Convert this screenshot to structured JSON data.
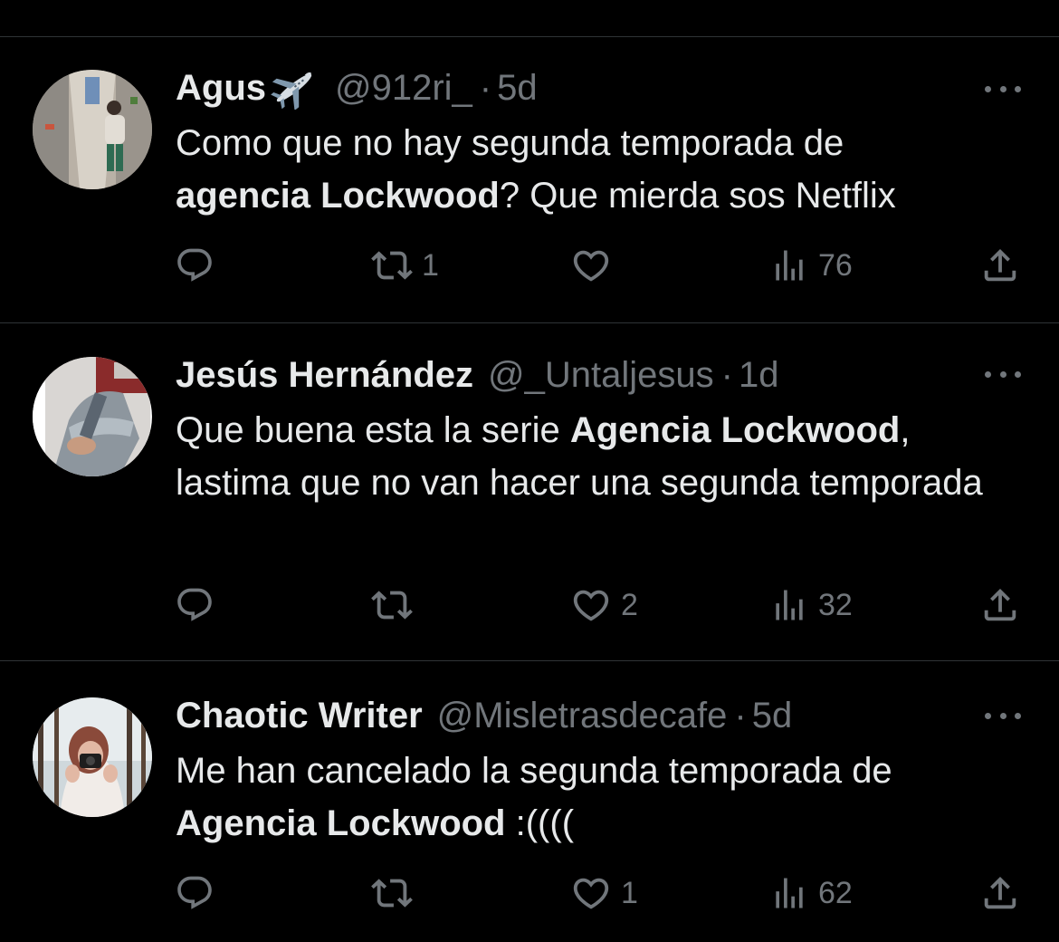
{
  "tweets": [
    {
      "name": "Agus",
      "name_emoji": "airplane-emoji",
      "handle": "@912ri_",
      "separator": "·",
      "time": "5d",
      "text_parts": [
        {
          "text": "Como que no hay segunda temporada de ",
          "bold": false
        },
        {
          "text": "agencia Lockwood",
          "bold": true
        },
        {
          "text": "? Que mierda sos Netflix",
          "bold": false
        }
      ],
      "replies": "",
      "retweets": "1",
      "likes": "",
      "views": "76"
    },
    {
      "name": "Jesús Hernández",
      "handle": "@_Untaljesus",
      "separator": "·",
      "time": "1d",
      "text_parts": [
        {
          "text": "Que buena esta la serie ",
          "bold": false
        },
        {
          "text": "Agencia Lockwood",
          "bold": true
        },
        {
          "text": ", lastima que no van hacer una segunda temporada",
          "bold": false
        }
      ],
      "replies": "",
      "retweets": "",
      "likes": "2",
      "views": "32"
    },
    {
      "name": "Chaotic Writer",
      "handle": "@Misletrasdecafe",
      "separator": "·",
      "time": "5d",
      "text_parts": [
        {
          "text": "Me han cancelado la segunda temporada de ",
          "bold": false
        },
        {
          "text": "Agencia Lockwood",
          "bold": true
        },
        {
          "text": " :((((",
          "bold": false
        }
      ],
      "replies": "",
      "retweets": "",
      "likes": "1",
      "views": "62"
    }
  ],
  "icons": {
    "reply": "reply-icon",
    "retweet": "retweet-icon",
    "like": "like-icon",
    "views": "views-icon",
    "share": "share-icon",
    "more": "more-icon"
  },
  "colors": {
    "background": "#000000",
    "text": "#e7e9ea",
    "secondary": "#71767b",
    "divider": "#2f3336"
  }
}
